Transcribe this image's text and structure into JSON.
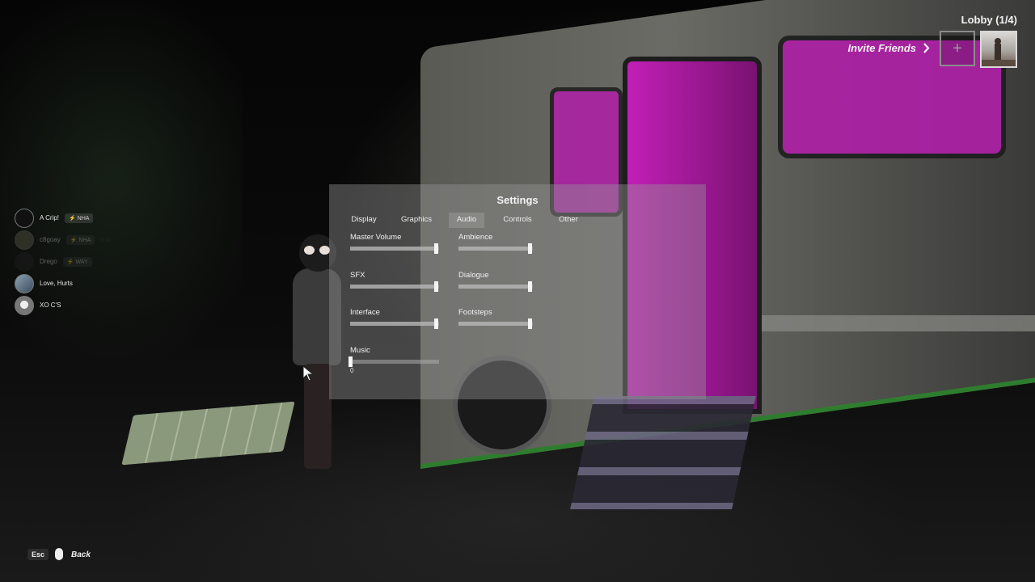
{
  "lobby": {
    "title": "Lobby (1/4)",
    "invite_label": "Invite Friends",
    "add_slot_symbol": "+"
  },
  "friends": [
    {
      "name": "A Crip!",
      "tag": "⚡ NHA",
      "status": "online"
    },
    {
      "name": "c8goay",
      "tag": "⚡ NHA",
      "status": "offline"
    },
    {
      "name": "Drego",
      "tag": "⚡ WAY",
      "status": "offline"
    },
    {
      "name": "Love, Hurts",
      "tag": "",
      "status": "online"
    },
    {
      "name": "XO C'S",
      "tag": "",
      "status": "online"
    }
  ],
  "settings": {
    "title": "Settings",
    "active_tab": "Audio",
    "tabs": [
      "Display",
      "Graphics",
      "Audio",
      "Controls",
      "Other"
    ],
    "sliders": [
      {
        "label": "Master Volume",
        "value": 0.96
      },
      {
        "label": "Ambience",
        "value": 0.96
      },
      {
        "label": "SFX",
        "value": 0.96
      },
      {
        "label": "Dialogue",
        "value": 0.96
      },
      {
        "label": "Interface",
        "value": 0.96
      },
      {
        "label": "Footsteps",
        "value": 0.96
      },
      {
        "label": "Music",
        "value": 0.0,
        "value_text": "0"
      }
    ]
  },
  "footer": {
    "esc_key": "Esc",
    "back_label": "Back"
  },
  "icons": {
    "invite": "chevron-right-icon",
    "add_slot": "plus-icon",
    "back": "mouse-icon"
  },
  "colors": {
    "panel": "#969696",
    "accent_pink": "#c21fb7",
    "rv_green": "#2e7d2e"
  }
}
